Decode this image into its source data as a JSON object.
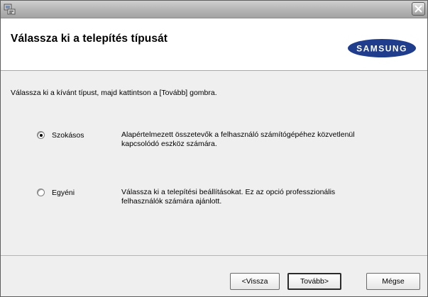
{
  "window": {
    "icon": "installer-icon",
    "close_icon": "close-icon"
  },
  "header": {
    "title": "Válassza ki a telepítés típusát",
    "logo_text": "SAMSUNG"
  },
  "body": {
    "instruction": "Válassza ki a kívánt típust, majd kattintson a [Tovább] gombra.",
    "options": [
      {
        "label": "Szokásos",
        "selected": true,
        "description_lines": [
          "Alapértelmezett összetevők a felhasználó számítógépéhez közvetlenül",
          "kapcsolódó eszköz számára."
        ]
      },
      {
        "label": "Egyéni",
        "selected": false,
        "description_lines": [
          "Válassza ki a telepítési beállításokat. Ez az opció professzionális",
          "felhasználók számára ajánlott."
        ]
      }
    ]
  },
  "buttons": {
    "back": "<Vissza",
    "next": "Tovább>",
    "cancel": "Mégse"
  },
  "colors": {
    "logo_blue": "#1f3c8d",
    "dialog_bg": "#efefef"
  }
}
